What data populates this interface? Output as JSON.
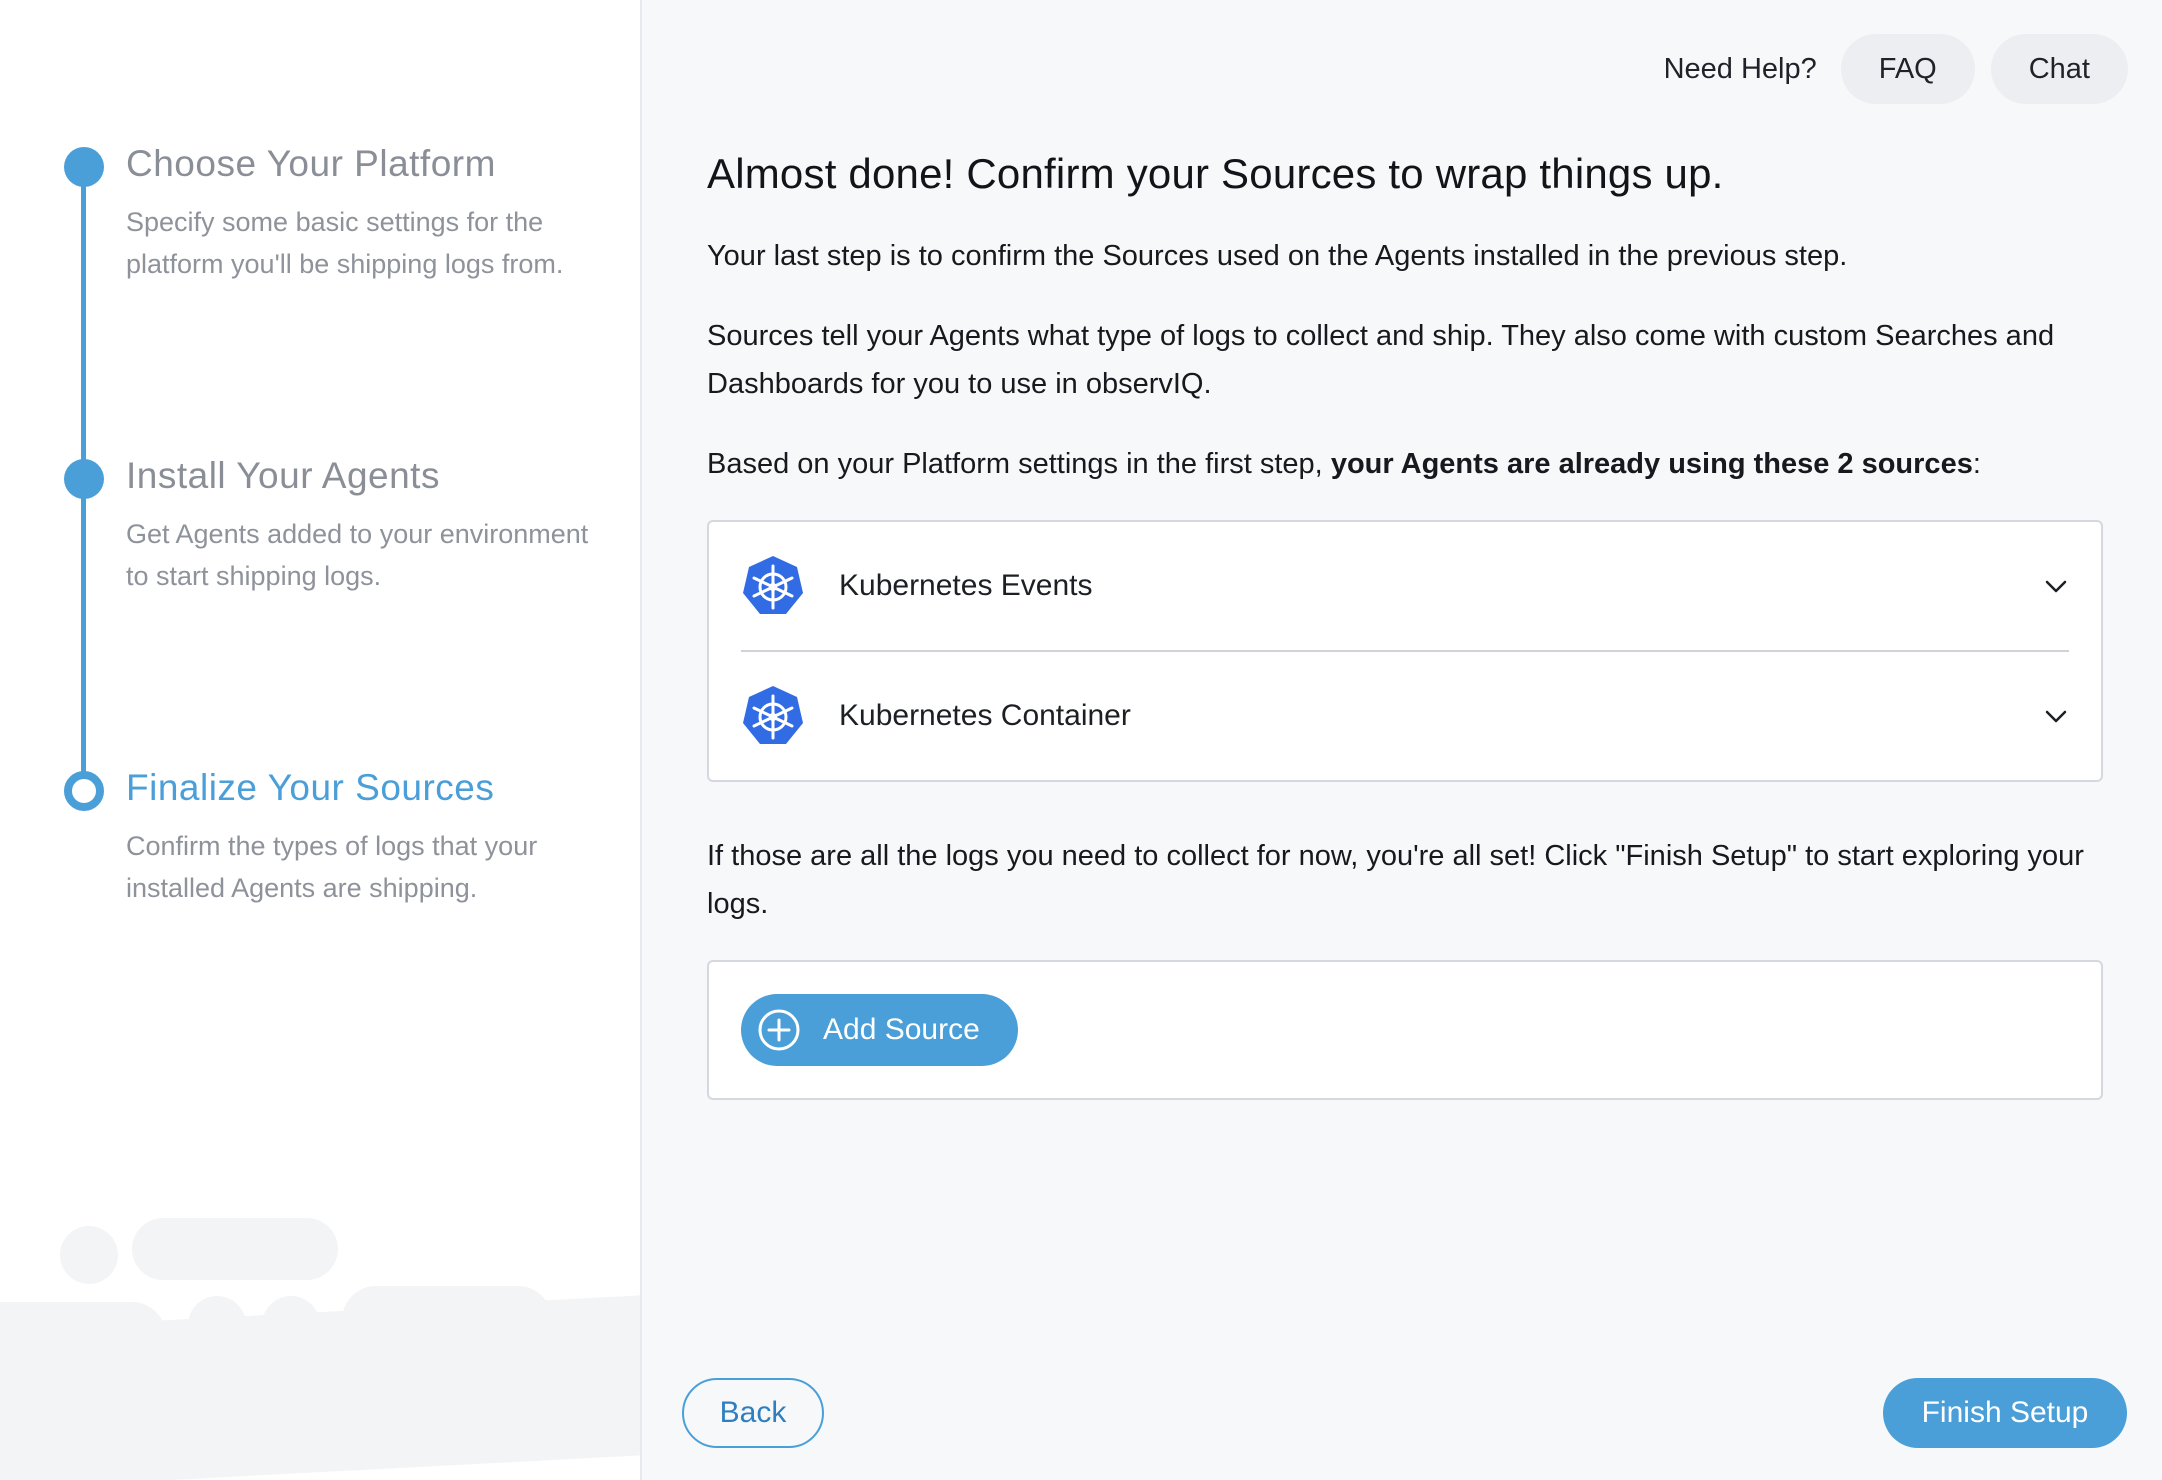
{
  "sidebar": {
    "steps": [
      {
        "title": "Choose Your Platform",
        "description": "Specify some basic settings for the platform you'll be shipping logs from.",
        "state": "complete"
      },
      {
        "title": "Install Your Agents",
        "description": "Get Agents added to your environment to start shipping logs.",
        "state": "complete"
      },
      {
        "title": "Finalize Your Sources",
        "description": "Confirm the types of logs that your installed Agents are shipping.",
        "state": "current"
      }
    ]
  },
  "help": {
    "label": "Need Help?",
    "faq_label": "FAQ",
    "chat_label": "Chat"
  },
  "main": {
    "heading": "Almost done! Confirm your Sources to wrap things up.",
    "intro": "Your last step is to confirm the Sources used on the Agents installed in the previous step.",
    "explanation": "Sources tell your Agents what type of logs to collect and ship. They also come with custom Searches and Dashboards for you to use in observIQ.",
    "based_on_prefix": "Based on your Platform settings in the first step, ",
    "based_on_bold": "your Agents are already using these 2 sources",
    "based_on_suffix": ":",
    "sources": [
      {
        "name": "Kubernetes Events",
        "icon": "kubernetes-icon"
      },
      {
        "name": "Kubernetes Container",
        "icon": "kubernetes-icon"
      }
    ],
    "finish_note": "If those are all the logs you need to collect for now, you're all set! Click \"Finish Setup\" to start exploring your logs.",
    "add_source_label": "Add Source"
  },
  "footer": {
    "back_label": "Back",
    "finish_label": "Finish Setup"
  },
  "colors": {
    "accent": "#4a9fd8",
    "kubernetes": "#326ce5"
  }
}
